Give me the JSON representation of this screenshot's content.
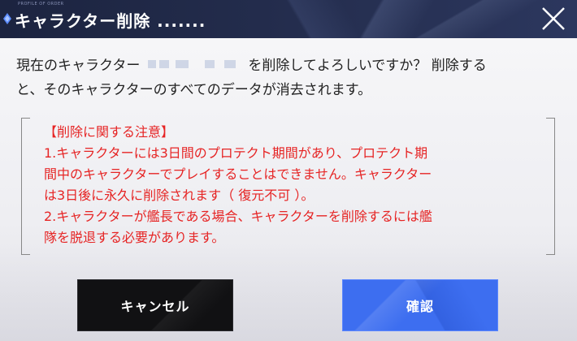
{
  "dialog": {
    "title": "キャラクター削除 .......",
    "header_small_text": "PROFILE OF ORDER",
    "close_label": "close",
    "message_before": "現在のキャラクター",
    "message_after": "を削除してよろしいですか？ 削除する",
    "message_line2": "と、そのキャラクターのすべてのデータが消去されます。",
    "notice": {
      "heading": "【削除に関する注意】",
      "lines": [
        "1.キャラクターには3日間のプロテクト期間があり、プロテクト期",
        "間中のキャラクターでプレイすることはできません。キャラクター",
        "は3日後に永久に削除されます（ 復元不可 ）。",
        "2.キャラクターが艦長である場合、キャラクターを削除するには艦",
        "隊を脱退する必要があります。"
      ]
    },
    "buttons": {
      "cancel": "キャンセル",
      "confirm": "確認"
    }
  },
  "colors": {
    "header_bg": "#1c2440",
    "notice_text": "#e62424",
    "confirm_bg": "#3d6ef0",
    "cancel_bg": "#111113"
  }
}
